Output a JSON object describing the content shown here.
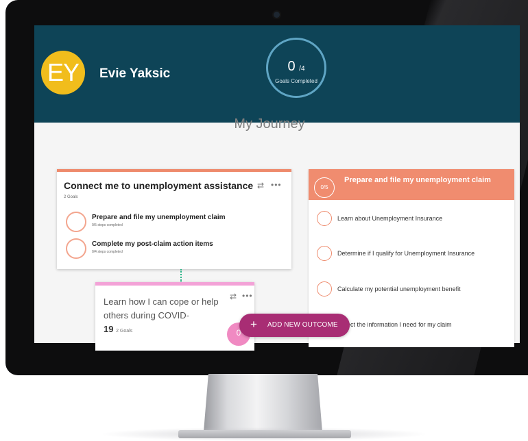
{
  "profile": {
    "initials": "EY",
    "name": "Evie Yaksic",
    "goals_completed": "0",
    "goals_total": "/4",
    "goals_label": "Goals Completed"
  },
  "journey": {
    "title": "My Journey"
  },
  "outcomes": [
    {
      "title": "Connect me to unemployment assistance",
      "subtitle": "2 Goals",
      "goals": [
        {
          "title": "Prepare and file my unemployment claim",
          "progress": "0/5 steps completed"
        },
        {
          "title": "Complete my post-claim action items",
          "progress": "0/4 steps completed"
        }
      ]
    },
    {
      "title_line1": "Learn how I can cope or help",
      "title_line2": "others during COVID-",
      "title_line3": "19",
      "subtitle": "2 Goals",
      "badge": "0"
    }
  ],
  "goal_detail": {
    "progress": "0/5",
    "title": "Prepare and file my unemployment claim",
    "steps": [
      "Learn about Unemployment Insurance",
      "Determine if I qualify for Unemployment Insurance",
      "Calculate my potential unemployment benefit",
      "ect the information I need for my claim"
    ]
  },
  "actions": {
    "add_outcome": "ADD NEW OUTCOME"
  },
  "colors": {
    "header_bg": "#0e4457",
    "avatar": "#f1bd1c",
    "accent_coral": "#f08c6f",
    "accent_pink": "#f3a2d7",
    "add_button": "#a82d74"
  },
  "icons": {
    "repeat": "repeat-icon",
    "more": "more-icon",
    "plus": "plus-icon"
  }
}
